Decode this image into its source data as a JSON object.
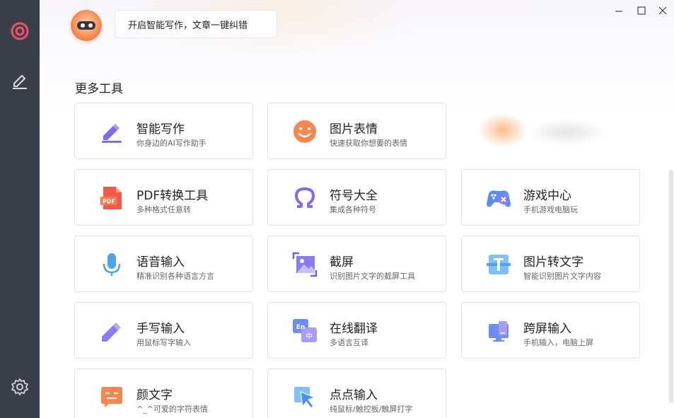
{
  "sidebar": {
    "items": [
      {
        "icon": "target-logo-icon"
      },
      {
        "icon": "pen-edit-icon"
      },
      {
        "icon": "gear-icon"
      }
    ]
  },
  "window": {
    "minimize": "—",
    "maximize": "☐",
    "close": "✕"
  },
  "header": {
    "bubble_text": "开启智能写作，文章一键纠错"
  },
  "section": {
    "title": "更多工具"
  },
  "tools": [
    {
      "title": "智能写作",
      "subtitle": "你身边的AI写作助手",
      "icon": "ai-write-icon"
    },
    {
      "title": "图片表情",
      "subtitle": "快速获取你想要的表情",
      "icon": "smile-icon"
    },
    {
      "title": "PDF转换工具",
      "subtitle": "多种格式任意转",
      "icon": "pdf-icon"
    },
    {
      "title": "符号大全",
      "subtitle": "集成各种符号",
      "icon": "omega-icon"
    },
    {
      "title": "游戏中心",
      "subtitle": "手机游戏电脑玩",
      "icon": "gamepad-icon"
    },
    {
      "title": "语音输入",
      "subtitle": "精准识别各种语言方言",
      "icon": "microphone-icon"
    },
    {
      "title": "截屏",
      "subtitle": "识别图片文字的截屏工具",
      "icon": "screenshot-icon"
    },
    {
      "title": "图片转文字",
      "subtitle": "智能识别图片文字内容",
      "icon": "image-to-text-icon"
    },
    {
      "title": "手写输入",
      "subtitle": "用鼠标写字输入",
      "icon": "handwrite-icon"
    },
    {
      "title": "在线翻译",
      "subtitle": "多语言互译",
      "icon": "translate-icon",
      "badge1": "En",
      "badge2": "中"
    },
    {
      "title": "跨屏输入",
      "subtitle": "手机输入，电脑上屏",
      "icon": "cross-screen-icon"
    },
    {
      "title": "颜文字",
      "subtitle": "^_^可爱的字符表情",
      "icon": "emoticon-icon"
    },
    {
      "title": "点点输入",
      "subtitle": "纯鼠标/触控板/触屏打字",
      "icon": "click-input-icon"
    }
  ],
  "colors": {
    "sidebar_bg": "#3b3f4a",
    "accent_orange": "#f4774a",
    "accent_purple": "#7b6cf0",
    "accent_blue": "#4aa3f2"
  }
}
